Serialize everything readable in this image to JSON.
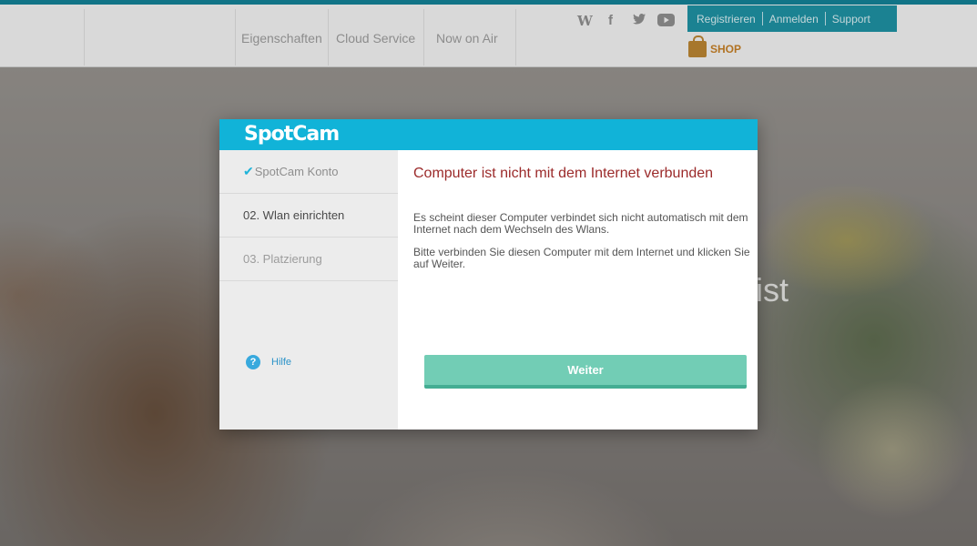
{
  "nav": {
    "items": [
      {
        "label": "Eigenschaften"
      },
      {
        "label": "Cloud Service"
      },
      {
        "label": "Now on Air"
      }
    ],
    "social_icons": [
      "wordpress-icon",
      "facebook-icon",
      "twitter-icon",
      "youtube-icon"
    ],
    "account_links": [
      {
        "label": "Registrieren"
      },
      {
        "label": "Anmelden"
      },
      {
        "label": "Support"
      }
    ],
    "shop_label": "SHOP"
  },
  "hero": {
    "text_fragment": "ist"
  },
  "modal": {
    "logo": "SpotCam",
    "steps": [
      {
        "label": "SpotCam Konto",
        "state": "done"
      },
      {
        "label": "02. Wlan einrichten",
        "state": "active"
      },
      {
        "label": "03. Platzierung",
        "state": "pending"
      }
    ],
    "help_label": "Hilfe",
    "title": "Computer ist nicht mit dem Internet verbunden",
    "paragraph1": "Es scheint dieser Computer verbindet sich nicht automatisch mit dem Internet nach dem Wechseln des Wlans.",
    "paragraph2": "Bitte verbinden Sie diesen Computer mit dem Internet und klicken Sie auf Weiter.",
    "button_label": "Weiter"
  },
  "colors": {
    "header": "#11b3d8",
    "account_bar": "#1a8fa1",
    "title": "#9b2a2a",
    "button": "#72cdb5",
    "shop": "#c47d22"
  }
}
